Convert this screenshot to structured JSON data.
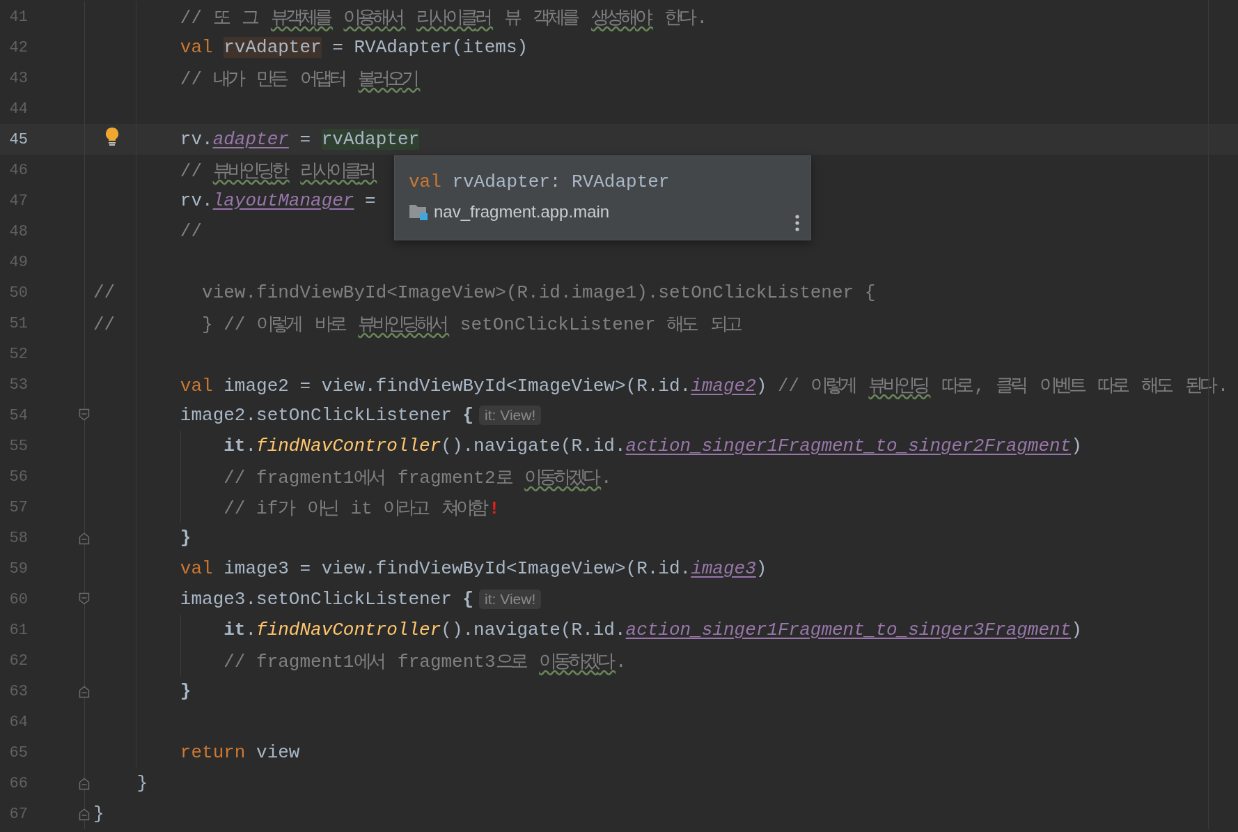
{
  "lines": [
    {
      "number": "41",
      "current": false,
      "tokens": [
        {
          "kind": "comment",
          "text": "        // 또 그 "
        },
        {
          "kind": "typo",
          "text": "뷰객체를"
        },
        {
          "kind": "typo",
          "text": " 이용해서"
        },
        {
          "kind": "typo",
          "text": " 리사이클러"
        },
        {
          "kind": "comment",
          "text": " 뷰 객체를 "
        },
        {
          "kind": "typo",
          "text": "생성해야"
        },
        {
          "kind": "comment",
          "text": " 한다."
        }
      ]
    },
    {
      "number": "42",
      "current": false,
      "tokens": [
        {
          "kind": "keyword",
          "text": "        val "
        },
        {
          "kind": "read_highlight",
          "text": "rvAdapter"
        },
        {
          "kind": "plain",
          "text": " = RVAdapter(items)"
        }
      ]
    },
    {
      "number": "43",
      "current": false,
      "tokens": [
        {
          "kind": "comment",
          "text": "        // 내가 만든 어댑터 "
        },
        {
          "kind": "typo",
          "text": "불러오기"
        }
      ]
    },
    {
      "number": "44",
      "current": false
    },
    {
      "number": "45",
      "current": true,
      "kind": "bulb",
      "tokens": [
        {
          "kind": "plain",
          "text": "        rv."
        },
        {
          "kind": "property",
          "text": "adapter"
        },
        {
          "kind": "plain",
          "text": " = "
        },
        {
          "kind": "write_highlight",
          "text": "rvAdapter"
        }
      ]
    },
    {
      "number": "46",
      "current": false,
      "tokens": [
        {
          "kind": "comment",
          "text": "        // "
        },
        {
          "kind": "typo",
          "text": "뷰바인딩한"
        },
        {
          "kind": "typo",
          "text": " 리사이클러"
        }
      ]
    },
    {
      "number": "47",
      "current": false,
      "tokens": [
        {
          "kind": "plain",
          "text": "        rv."
        },
        {
          "kind": "property",
          "text": "layoutManager"
        },
        {
          "kind": "plain",
          "text": " ="
        }
      ]
    },
    {
      "number": "48",
      "current": false,
      "tokens": [
        {
          "kind": "comment",
          "text": "        //"
        }
      ]
    },
    {
      "number": "49",
      "current": false
    },
    {
      "number": "50",
      "current": false,
      "tokens": [
        {
          "kind": "comment",
          "text": "//        view.findViewById<ImageView>(R.id.image1).setOnClickListener {"
        }
      ]
    },
    {
      "number": "51",
      "current": false,
      "tokens": [
        {
          "kind": "comment",
          "text": "//        } // 이렇게 바로 "
        },
        {
          "kind": "typo",
          "text": "뷰바인딩해서"
        },
        {
          "kind": "comment",
          "text": " setOnClickListener 해도 되고"
        }
      ]
    },
    {
      "number": "52",
      "current": false
    },
    {
      "number": "53",
      "current": false,
      "tokens": [
        {
          "kind": "keyword",
          "text": "        val"
        },
        {
          "kind": "plain",
          "text": " image2 = view.findViewById<ImageView>(R.id."
        },
        {
          "kind": "property",
          "text": "image2"
        },
        {
          "kind": "plain",
          "text": ") "
        },
        {
          "kind": "comment",
          "text": "// 이렇게 "
        },
        {
          "kind": "typo",
          "text": "뷰바인딩"
        },
        {
          "kind": "comment",
          "text": " 따로, 클릭 이벤트 따로 해도 된다."
        }
      ]
    },
    {
      "number": "54",
      "current": false,
      "kind": "fold_start",
      "tokens": [
        {
          "kind": "plain",
          "text": "        image2.setOnClickListener "
        },
        {
          "kind": "bold",
          "text": "{"
        }
      ],
      "hint": "it: View!"
    },
    {
      "number": "55",
      "current": false,
      "tokens": [
        {
          "kind": "bold",
          "text": "            it"
        },
        {
          "kind": "plain",
          "text": "."
        },
        {
          "kind": "call",
          "text": "findNavController"
        },
        {
          "kind": "plain",
          "text": "().navigate(R.id."
        },
        {
          "kind": "property",
          "text": "action_singer1Fragment_to_singer2Fragment"
        },
        {
          "kind": "plain",
          "text": ")"
        }
      ]
    },
    {
      "number": "56",
      "current": false,
      "tokens": [
        {
          "kind": "comment",
          "text": "            // fragment1에서 fragment2로 "
        },
        {
          "kind": "typo",
          "text": "이동하겠다"
        },
        {
          "kind": "comment",
          "text": "."
        }
      ]
    },
    {
      "number": "57",
      "current": false,
      "tokens": [
        {
          "kind": "comment",
          "text": "            // if가 아닌 it 이라고 쳐야함"
        },
        {
          "kind": "error",
          "text": "!"
        }
      ]
    },
    {
      "number": "58",
      "current": false,
      "kind": "fold_end",
      "tokens": [
        {
          "kind": "bold",
          "text": "        }"
        }
      ]
    },
    {
      "number": "59",
      "current": false,
      "tokens": [
        {
          "kind": "keyword",
          "text": "        val"
        },
        {
          "kind": "plain",
          "text": " image3 = view.findViewById<ImageView>(R.id."
        },
        {
          "kind": "property",
          "text": "image3"
        },
        {
          "kind": "plain",
          "text": ")"
        }
      ]
    },
    {
      "number": "60",
      "current": false,
      "kind": "fold_start",
      "tokens": [
        {
          "kind": "plain",
          "text": "        image3.setOnClickListener "
        },
        {
          "kind": "bold",
          "text": "{"
        }
      ],
      "hint": "it: View!"
    },
    {
      "number": "61",
      "current": false,
      "tokens": [
        {
          "kind": "bold",
          "text": "            it"
        },
        {
          "kind": "plain",
          "text": "."
        },
        {
          "kind": "call",
          "text": "findNavController"
        },
        {
          "kind": "plain",
          "text": "().navigate(R.id."
        },
        {
          "kind": "property",
          "text": "action_singer1Fragment_to_singer3Fragment"
        },
        {
          "kind": "plain",
          "text": ")"
        }
      ]
    },
    {
      "number": "62",
      "current": false,
      "tokens": [
        {
          "kind": "comment",
          "text": "            // fragment1에서 fragment3으로 "
        },
        {
          "kind": "typo",
          "text": "이동하겠다"
        },
        {
          "kind": "comment",
          "text": "."
        }
      ]
    },
    {
      "number": "63",
      "current": false,
      "kind": "fold_end",
      "tokens": [
        {
          "kind": "bold",
          "text": "        }"
        }
      ]
    },
    {
      "number": "64",
      "current": false
    },
    {
      "number": "65",
      "current": false,
      "tokens": [
        {
          "kind": "keyword",
          "text": "        return"
        },
        {
          "kind": "plain",
          "text": " view"
        }
      ]
    },
    {
      "number": "66",
      "current": false,
      "kind": "fold_end",
      "tokens": [
        {
          "kind": "plain",
          "text": "    }"
        }
      ]
    },
    {
      "number": "67",
      "current": false,
      "kind": "fold_end",
      "tokens": [
        {
          "kind": "plain",
          "text": "}"
        }
      ]
    }
  ],
  "popup": {
    "signature": [
      {
        "kind": "keyword",
        "text": "val"
      },
      {
        "kind": "plain",
        "text": " rvAdapter: RVAdapter"
      }
    ],
    "location": "nav_fragment.app.main"
  }
}
